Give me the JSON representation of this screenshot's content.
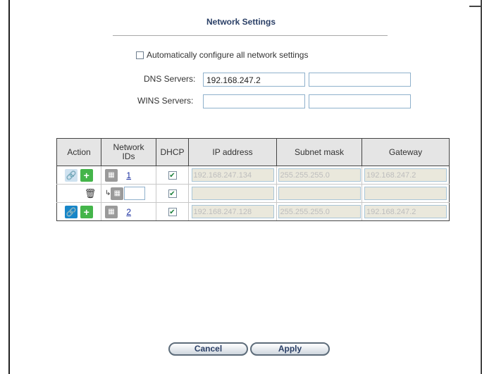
{
  "dialog": {
    "title": "Network Settings",
    "auto_configure_label": "Automatically configure all network settings",
    "auto_configure_checked": false
  },
  "dns": {
    "label": "DNS Servers:",
    "primary": "192.168.247.2",
    "secondary": ""
  },
  "wins": {
    "label": "WINS Servers:",
    "primary": "",
    "secondary": ""
  },
  "table": {
    "headers": {
      "action": "Action",
      "network_ids_line1": "Network",
      "network_ids_line2": "IDs",
      "dhcp": "DHCP",
      "ip": "IP address",
      "subnet": "Subnet mask",
      "gateway": "Gateway"
    },
    "rows": [
      {
        "network_id": "1",
        "dhcp": true,
        "ip": "192.168.247.134",
        "subnet": "255.255.255.0",
        "gateway": "192.168.247.2"
      },
      {
        "network_id": "",
        "dhcp": true,
        "ip": "",
        "subnet": "",
        "gateway": ""
      },
      {
        "network_id": "2",
        "dhcp": true,
        "ip": "192.168.247.128",
        "subnet": "255.255.255.0",
        "gateway": "192.168.247.2"
      }
    ]
  },
  "buttons": {
    "cancel": "Cancel",
    "apply": "Apply"
  },
  "icons": {
    "link": "link-icon",
    "add": "plus-icon",
    "network": "network-icon",
    "delete": "trash-icon",
    "dhcp_check": "checkmark-icon"
  }
}
